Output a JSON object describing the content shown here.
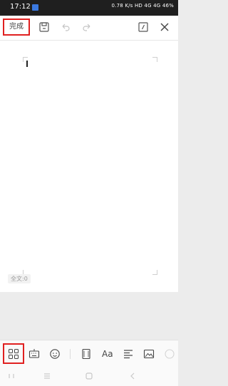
{
  "status_bar": {
    "time": "17:12",
    "indicators": "0.78 K/s  HD  4G  4G  46%"
  },
  "toolbar": {
    "done_label": "完成"
  },
  "editor": {
    "word_count": "全文:0"
  },
  "bottom_toolbar": {
    "font_label": "Aa"
  },
  "colors": {
    "highlight": "#e02020",
    "status_bg": "#1f1f1f"
  }
}
